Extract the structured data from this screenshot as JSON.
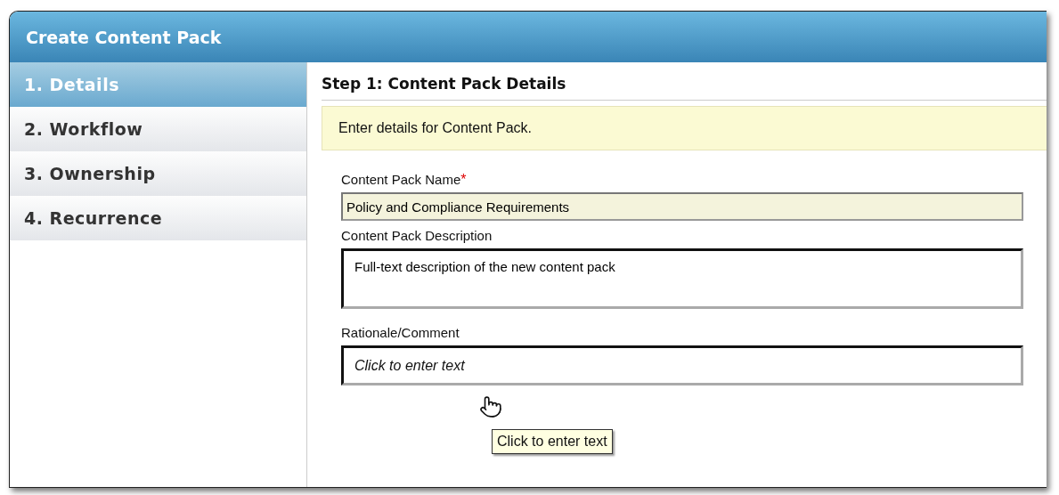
{
  "window": {
    "title": "Create Content Pack"
  },
  "steps": [
    {
      "label": "1. Details",
      "selected": true
    },
    {
      "label": "2. Workflow",
      "selected": false
    },
    {
      "label": "3. Ownership",
      "selected": false
    },
    {
      "label": "4. Recurrence",
      "selected": false
    }
  ],
  "step_title": "Step 1: Content Pack Details",
  "info": "Enter details for Content Pack.",
  "fields": [
    {
      "kind": "input",
      "label": "Content Pack Name",
      "required_mark": "*",
      "value": "Policy and Compliance Requirements"
    },
    {
      "kind": "textarea",
      "label": "Content Pack Description",
      "value": "Full-text description of the new content pack"
    },
    {
      "kind": "comment",
      "label": "Rationale/Comment",
      "placeholder": "Click to enter text"
    }
  ],
  "tooltip": "Click to enter text"
}
